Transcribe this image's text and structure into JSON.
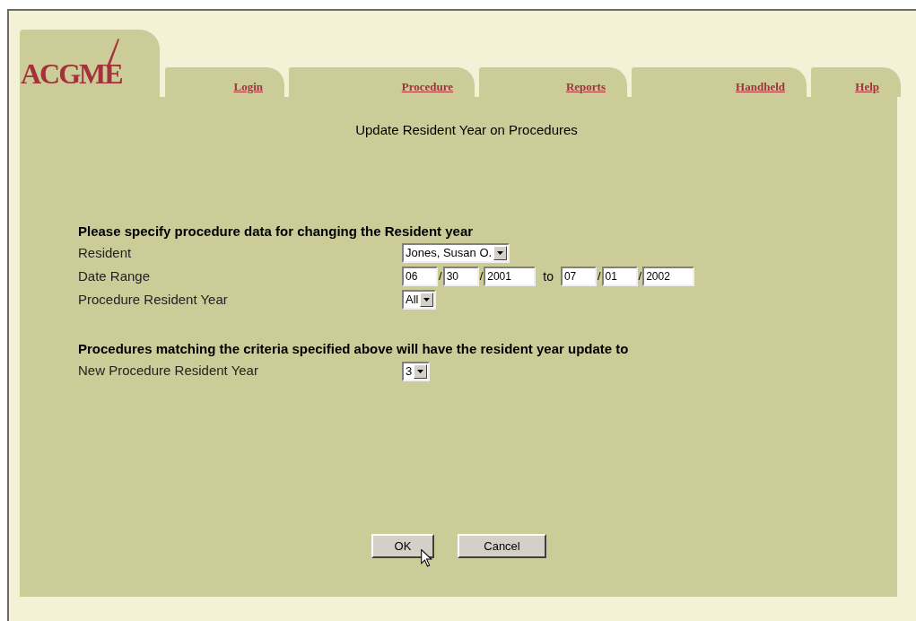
{
  "logo": "ACGME",
  "tabs": [
    {
      "label": "Login",
      "selected": false
    },
    {
      "label": "Procedure",
      "selected": false
    },
    {
      "label": "Reports",
      "selected": false
    },
    {
      "label": "Handheld",
      "selected": false
    },
    {
      "label": "Help",
      "selected": false
    }
  ],
  "title": "Update Resident Year on Procedures",
  "sections": [
    {
      "heading": "Please specify procedure data for changing the Resident year",
      "rows": [
        {
          "kind": "select",
          "label": "Resident",
          "value": "Jones, Susan O."
        },
        {
          "kind": "dates",
          "label": "Date Range",
          "start": [
            {
              "value": "06"
            },
            {
              "sep": "/",
              "value": "30"
            },
            {
              "sep": "/",
              "value": "2001"
            }
          ],
          "to": "to",
          "end": [
            {
              "value": "07"
            },
            {
              "sep": "/",
              "value": "01"
            },
            {
              "sep": "/",
              "value": "2002"
            }
          ]
        },
        {
          "kind": "select",
          "label": "Procedure Resident Year",
          "value": "All"
        }
      ]
    },
    {
      "heading": "Procedures matching the criteria specified above will have the resident year update to",
      "rows": [
        {
          "kind": "select",
          "label": "New Procedure Resident Year",
          "value": "3"
        }
      ]
    }
  ],
  "buttons": [
    "OK",
    "Cancel"
  ]
}
